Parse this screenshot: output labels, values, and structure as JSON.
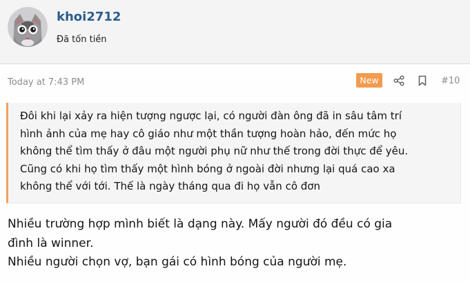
{
  "user": {
    "username": "khoi2712",
    "title": "Đã tốn tiền"
  },
  "post": {
    "timestamp": "Today at 7:43 PM",
    "badge": "New",
    "number": "#10",
    "quote_lines": [
      "Đôi khi lại xảy ra hiện tượng ngược lại, có người đàn ông đã in sâu tâm trí",
      "hình ảnh của mẹ hay cô giáo như một thần tượng hoàn hảo, đến mức họ",
      "không thể tìm thấy ở đâu một người phụ nữ như thế trong đời thực để yêu.",
      "Cũng có khi họ tìm thấy một hình bóng ở ngoài đời nhưng lại quá cao xa",
      "không thể với tới. Thế là ngày tháng qua đi họ vẫn cô đơn"
    ],
    "body_lines": [
      "Nhiều trường hợp mình biết là dạng này. Mấy người đó đều có gia",
      "đình là winner.",
      "Nhiều người chọn vợ, bạn gái có hình bóng của người mẹ."
    ]
  },
  "icons": {
    "share": "share-icon",
    "bookmark": "bookmark-icon",
    "avatar": "cat-avatar"
  },
  "colors": {
    "username": "#2b5d8a",
    "badge": "#f39b4e",
    "quote_border": "#f0a160",
    "header_bg": "#f4f4f5"
  }
}
